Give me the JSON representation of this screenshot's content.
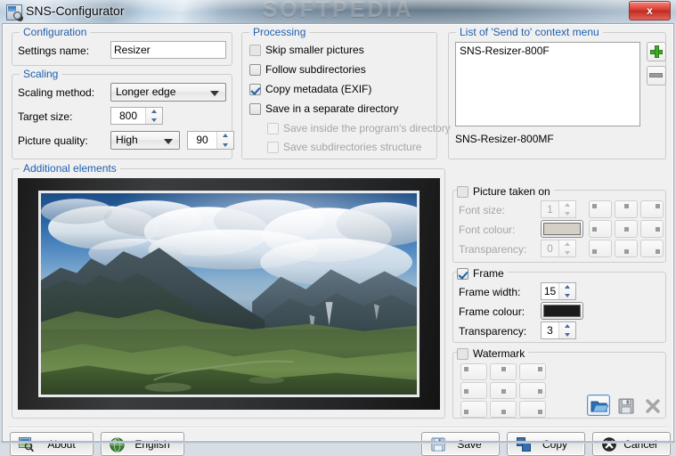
{
  "window": {
    "title": "SNS-Configurator",
    "background_watermark": "SOFTPEDIA",
    "close_label": "x",
    "icon": "app-picture-icon"
  },
  "configuration": {
    "legend": "Configuration",
    "settings_name_label": "Settings name:",
    "settings_name_value": "Resizer"
  },
  "scaling": {
    "legend": "Scaling",
    "method_label": "Scaling method:",
    "method_value": "Longer edge",
    "target_size_label": "Target size:",
    "target_size_value": "800",
    "quality_label": "Picture quality:",
    "quality_value": "High",
    "quality_number": "90"
  },
  "processing": {
    "legend": "Processing",
    "items": [
      {
        "label": "Skip smaller pictures",
        "checked": false,
        "enabled": true
      },
      {
        "label": "Follow subdirectories",
        "checked": false,
        "enabled": true
      },
      {
        "label": "Copy metadata (EXIF)",
        "checked": true,
        "enabled": true
      },
      {
        "label": "Save in a separate directory",
        "checked": false,
        "enabled": true
      },
      {
        "label": "Save inside the program's directory",
        "checked": false,
        "enabled": false
      },
      {
        "label": "Save subdirectories structure",
        "checked": false,
        "enabled": false
      }
    ]
  },
  "sendto": {
    "legend": "List of 'Send to' context menu",
    "items": [
      "SNS-Resizer-800F"
    ],
    "status_text": "SNS-Resizer-800MF",
    "add_icon": "plus-icon",
    "remove_icon": "minus-icon"
  },
  "additional": {
    "legend": "Additional elements"
  },
  "picture_taken_on": {
    "legend": "Picture taken on",
    "checked": false,
    "font_size_label": "Font size:",
    "font_size_value": "1",
    "font_colour_label": "Font colour:",
    "font_colour_value": "#d4d0c8",
    "transparency_label": "Transparency:",
    "transparency_value": "0",
    "position_tiles": [
      "top-left",
      "top-center",
      "top-right",
      "middle-left",
      "middle-center",
      "middle-right",
      "bottom-left",
      "bottom-center",
      "bottom-right"
    ]
  },
  "frame": {
    "legend": "Frame",
    "checked": true,
    "width_label": "Frame width:",
    "width_value": "15",
    "colour_label": "Frame colour:",
    "colour_value": "#1b1b1b",
    "transparency_label": "Transparency:",
    "transparency_value": "3"
  },
  "watermark": {
    "legend": "Watermark",
    "checked": false,
    "position_tiles": [
      "top-left",
      "top-center",
      "top-right",
      "middle-left",
      "middle-center",
      "middle-right",
      "bottom-left",
      "bottom-center",
      "bottom-right"
    ],
    "open_icon": "open-folder-icon",
    "save_icon": "floppy-save-icon",
    "delete_icon": "x-delete-icon"
  },
  "footer": {
    "about_label": "About",
    "about_icon": "about-picture-icon",
    "language_label": "English",
    "language_icon": "globe-icon",
    "save_label": "Save",
    "save_icon": "floppy-save-icon",
    "copy_label": "Copy",
    "copy_icon": "copy-icon",
    "cancel_label": "Cancel",
    "cancel_icon": "cancel-circle-icon"
  },
  "colors": {
    "legend_blue": "#1f5fb0",
    "accent_green": "#3faa26",
    "close_red": "#dd3f36"
  }
}
